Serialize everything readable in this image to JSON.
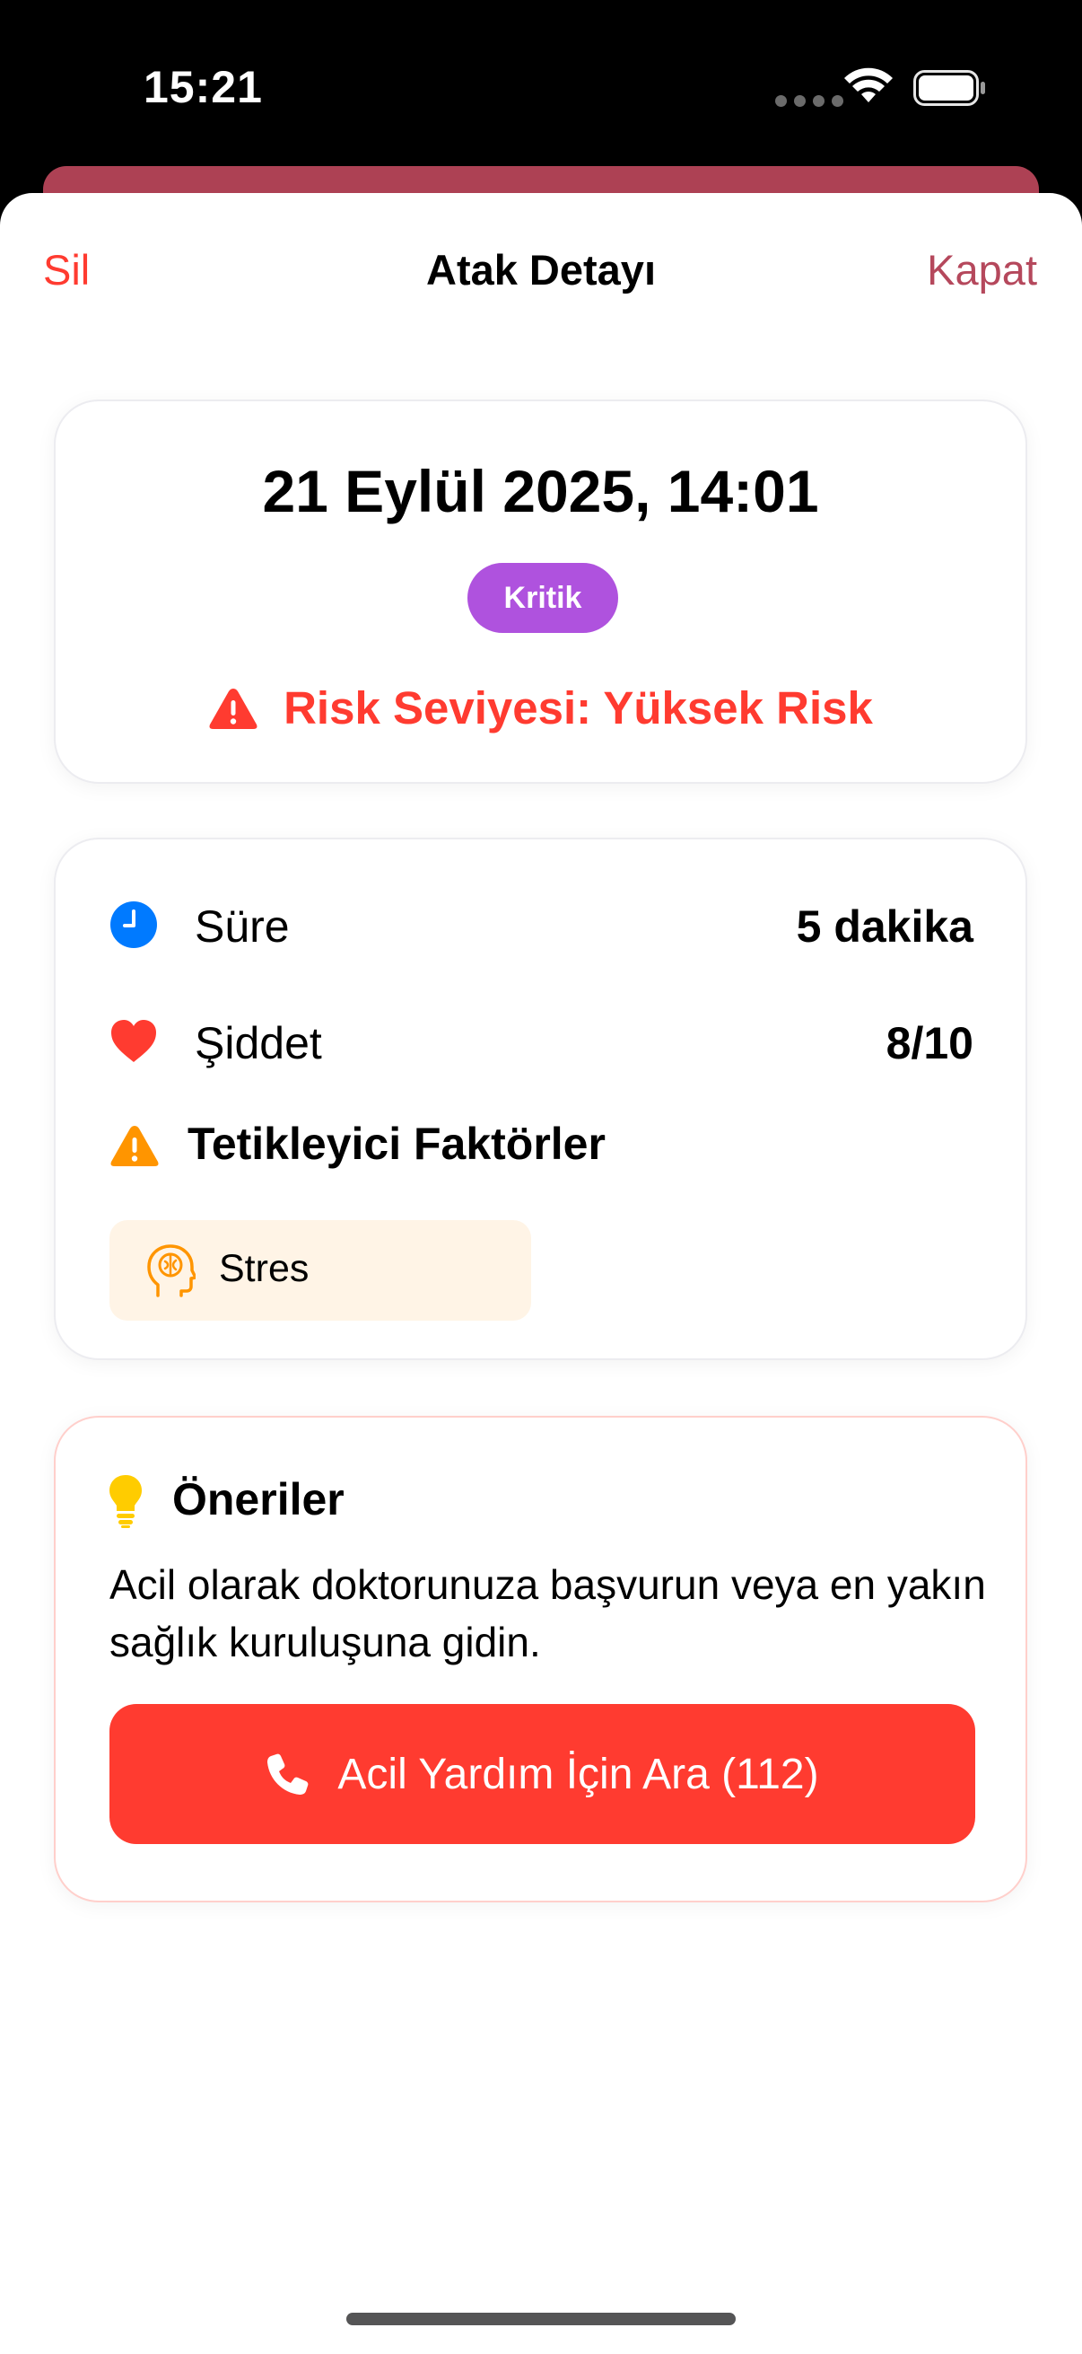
{
  "status_bar": {
    "time": "15:21",
    "icons": [
      "signal-icon",
      "wifi-icon",
      "battery-icon"
    ]
  },
  "nav": {
    "left_label": "Sil",
    "title": "Atak Detayı",
    "right_label": "Kapat"
  },
  "header_card": {
    "date": "21 Eylül 2025, 14:01",
    "badge": "Kritik",
    "risk_text": "Risk Seviyesi: Yüksek Risk"
  },
  "info_card": {
    "duration_label": "Süre",
    "duration_value": "5 dakika",
    "severity_label": "Şiddet",
    "severity_value": "8/10",
    "triggers_title": "Tetikleyici Faktörler",
    "triggers": [
      "Stres"
    ]
  },
  "recommendations": {
    "title": "Öneriler",
    "text": "Acil olarak doktorunuza başvurun veya en yakın sağlık kuruluşuna gidin.",
    "call_button": "Acil Yardım İçin Ara (112)"
  },
  "colors": {
    "destructive": "#ff3b30",
    "accent": "#b5485c",
    "badge": "#af52de",
    "clock": "#007aff",
    "warning": "#ff9500",
    "bulb": "#ffcc00",
    "chip_background": "#fff4e6"
  }
}
